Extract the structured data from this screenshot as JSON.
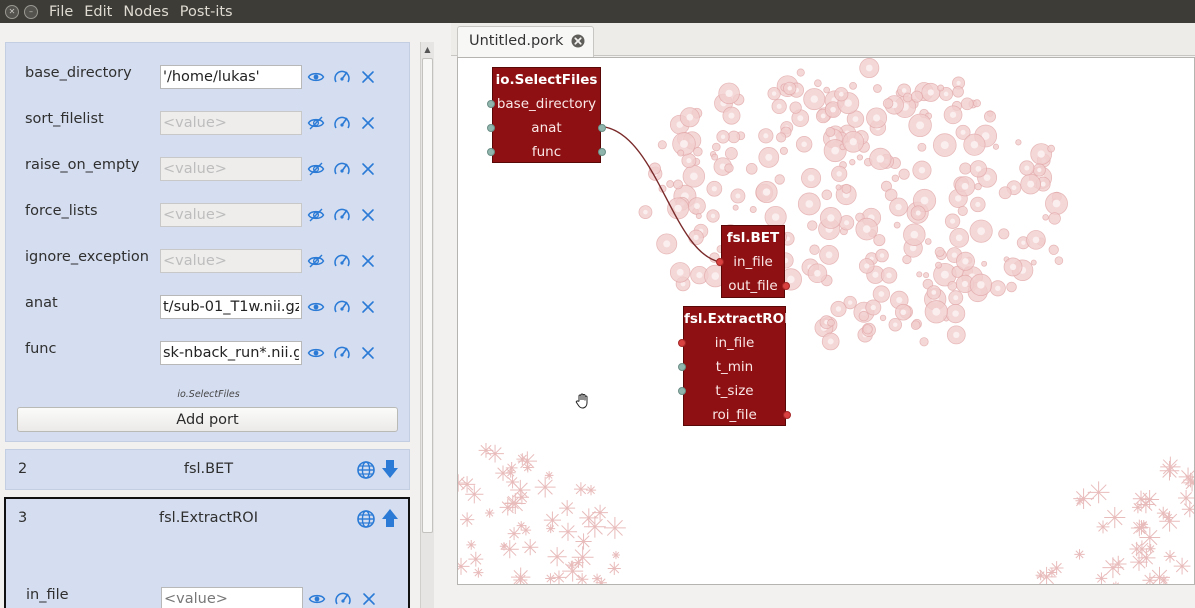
{
  "menubar": {
    "items": [
      "File",
      "Edit",
      "Nodes",
      "Post-its"
    ]
  },
  "node_panel_1": {
    "properties": [
      {
        "label": "base_directory",
        "value": "'/home/lukas'",
        "placeholder": "",
        "enabled": true
      },
      {
        "label": "sort_filelist",
        "value": "",
        "placeholder": "<value>",
        "enabled": false
      },
      {
        "label": "raise_on_empty",
        "value": "",
        "placeholder": "<value>",
        "enabled": false
      },
      {
        "label": "force_lists",
        "value": "",
        "placeholder": "<value>",
        "enabled": false
      },
      {
        "label": "ignore_exception",
        "value": "",
        "placeholder": "<value>",
        "enabled": false
      },
      {
        "label": "anat",
        "value": "t/sub-01_T1w.nii.gz'",
        "placeholder": "",
        "enabled": true
      },
      {
        "label": "func",
        "value": "sk-nback_run*.nii.gz'",
        "placeholder": "",
        "enabled": true
      }
    ],
    "caption": "io.SelectFiles",
    "add_port_label": "Add port"
  },
  "node_panel_2": {
    "number": "2",
    "title": "fsl.BET",
    "arrow": "down"
  },
  "node_panel_3": {
    "number": "3",
    "title": "fsl.ExtractROI",
    "arrow": "up",
    "properties": [
      {
        "label": "in_file",
        "value": "",
        "placeholder": "<value>",
        "enabled": true
      }
    ]
  },
  "editor": {
    "tab_title": "Untitled.pork",
    "nodes": [
      {
        "id": "select-files",
        "title": "io.SelectFiles",
        "ports": [
          "base_directory",
          "anat",
          "func"
        ]
      },
      {
        "id": "bet",
        "title": "fsl.BET",
        "ports": [
          "in_file",
          "out_file"
        ]
      },
      {
        "id": "extract-roi",
        "title": "fsl.ExtractROI",
        "ports": [
          "in_file",
          "t_min",
          "t_size",
          "roi_file"
        ]
      }
    ]
  },
  "colors": {
    "panel_bg": "#d5def0",
    "node_bg": "#8e1012",
    "icon_blue": "#2a7ad6",
    "menubar_bg": "#3d3c37"
  }
}
